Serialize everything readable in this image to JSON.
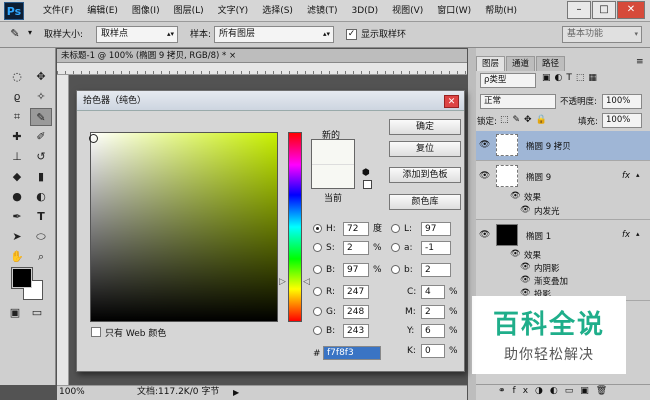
{
  "app": {
    "logo": "Ps"
  },
  "menu": [
    "文件(F)",
    "编辑(E)",
    "图像(I)",
    "图层(L)",
    "文字(Y)",
    "选择(S)",
    "滤镜(T)",
    "3D(D)",
    "视图(V)",
    "窗口(W)",
    "帮助(H)"
  ],
  "window_controls": {
    "minimize": "–",
    "maximize": "□",
    "close": "✕"
  },
  "options": {
    "sample_size_label": "取样大小:",
    "sample_size_value": "取样点",
    "sample_label": "样本:",
    "sample_value": "所有图层",
    "show_ring_label": "显示取样环",
    "show_ring_checked": true,
    "workspace": "基本功能"
  },
  "document": {
    "tab": "未标题-1 @ 100% (椭圆 9 拷贝, RGB/8) * ×",
    "status_zoom": "100%",
    "status_doc": "文档:117.2K/0 字节"
  },
  "panel": {
    "tabs": [
      "图层",
      "通道",
      "路径"
    ],
    "kind_label": "ρ类型",
    "blend_mode": "正常",
    "opacity_label": "不透明度:",
    "opacity_value": "100%",
    "lock_label": "锁定:",
    "fill_label": "填充:",
    "fill_value": "100%",
    "layers": [
      {
        "name": "椭圆 9 拷贝",
        "selected": true
      },
      {
        "name": "椭圆 9",
        "fx": "fx",
        "effects_label": "效果",
        "effects": [
          "内发光"
        ]
      },
      {
        "name": "椭圆 1",
        "fx": "fx",
        "effects_label": "效果",
        "effects": [
          "内阴影",
          "渐变叠加",
          "投影"
        ]
      }
    ]
  },
  "badge": {
    "title": "百科全说",
    "subtitle": "助你轻松解决"
  },
  "dialog": {
    "title": "拾色器（纯色）",
    "close": "✕",
    "new_label": "新的",
    "current_label": "当前",
    "new_color": "#f7f8f3",
    "current_color": "#f7f8f3",
    "buttons": {
      "ok": "确定",
      "reset": "复位",
      "add_swatch": "添加到色板",
      "color_library": "颜色库"
    },
    "web_only": "只有 Web 颜色",
    "hsb": {
      "H": "72",
      "H_unit": "度",
      "S": "2",
      "S_unit": "%",
      "B": "97",
      "B_unit": "%"
    },
    "rgb": {
      "R": "247",
      "G": "248",
      "B": "243"
    },
    "lab": {
      "L": "97",
      "a": "-1",
      "b": "2"
    },
    "cmyk": {
      "C": "4",
      "M": "2",
      "Y": "6",
      "K": "0",
      "unit": "%"
    },
    "hex_label": "#",
    "hex": "f7f8f3"
  }
}
